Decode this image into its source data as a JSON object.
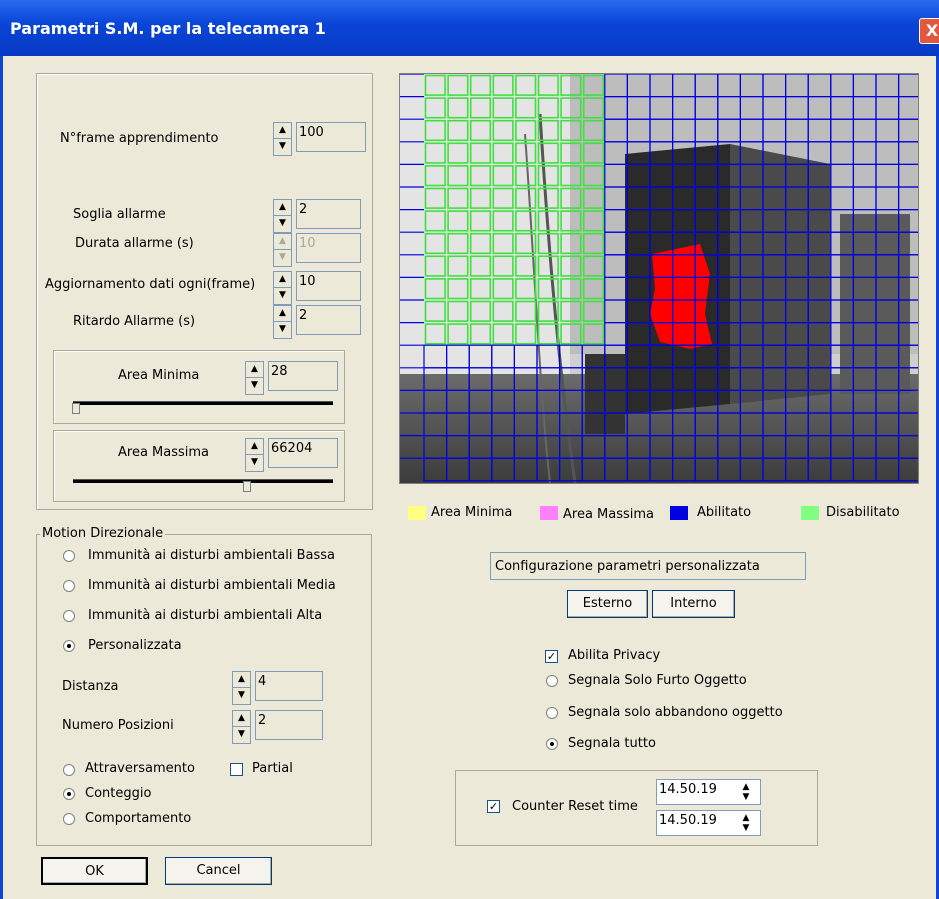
{
  "window": {
    "title": "Parametri S.M. per la telecamera 1",
    "close_label": "X"
  },
  "params": {
    "learning_frames": {
      "label": "N°frame apprendimento",
      "value": "100"
    },
    "alarm_threshold": {
      "label": "Soglia allarme",
      "value": "2"
    },
    "alarm_duration": {
      "label": "Durata allarme (s)",
      "value": "10"
    },
    "data_update": {
      "label": "Aggiornamento dati ogni(frame)",
      "value": "10"
    },
    "alarm_delay": {
      "label": "Ritardo Allarme (s)",
      "value": "2"
    }
  },
  "area_min": {
    "label": "Area Minima",
    "value": "28",
    "slider_fraction": 0.0
  },
  "area_max": {
    "label": "Area Massima",
    "value": "66204",
    "slider_fraction": 0.66
  },
  "motion": {
    "title": "Motion Direzionale",
    "options": [
      {
        "label": "Immunità ai disturbi ambientali Bassa",
        "selected": false
      },
      {
        "label": "Immunità ai disturbi ambientali Media",
        "selected": false
      },
      {
        "label": "Immunità ai disturbi ambientali Alta",
        "selected": false
      },
      {
        "label": "Personalizzata",
        "selected": true
      }
    ],
    "distance": {
      "label": "Distanza",
      "value": "4"
    },
    "positions": {
      "label": "Numero Posizioni",
      "value": "2"
    },
    "modes": [
      {
        "label": "Attraversamento",
        "selected": false
      },
      {
        "label": "Conteggio",
        "selected": true
      },
      {
        "label": "Comportamento",
        "selected": false
      }
    ],
    "partial": {
      "label": "Partial",
      "checked": false
    }
  },
  "legend": [
    {
      "label": "Area Minima",
      "color": "#ffff80"
    },
    {
      "label": "Area Massima",
      "color": "#ff80ff"
    },
    {
      "label": "Abilitato",
      "color": "#0000e0"
    },
    {
      "label": "Disabilitato",
      "color": "#80ff80"
    }
  ],
  "config": {
    "text": "Configurazione parametri personalizzata",
    "esterno_label": "Esterno",
    "interno_label": "Interno"
  },
  "privacy": {
    "enable_label": "Abilita Privacy",
    "enable_checked": true,
    "options": [
      {
        "label": "Segnala Solo Furto Oggetto",
        "selected": false
      },
      {
        "label": "Segnala solo abbandono oggetto",
        "selected": false
      },
      {
        "label": "Segnala tutto",
        "selected": true
      }
    ]
  },
  "counter_reset": {
    "label": "Counter Reset time",
    "checked": true,
    "time1": "14.50.19",
    "time2": "14.50.19"
  },
  "buttons": {
    "ok_label": "OK",
    "cancel_label": "Cancel"
  },
  "colors": {
    "titlebar": "#0a46d8",
    "grid_enabled": "#0000e0",
    "grid_disabled": "#40e040",
    "motion_blob": "#ff0000"
  }
}
